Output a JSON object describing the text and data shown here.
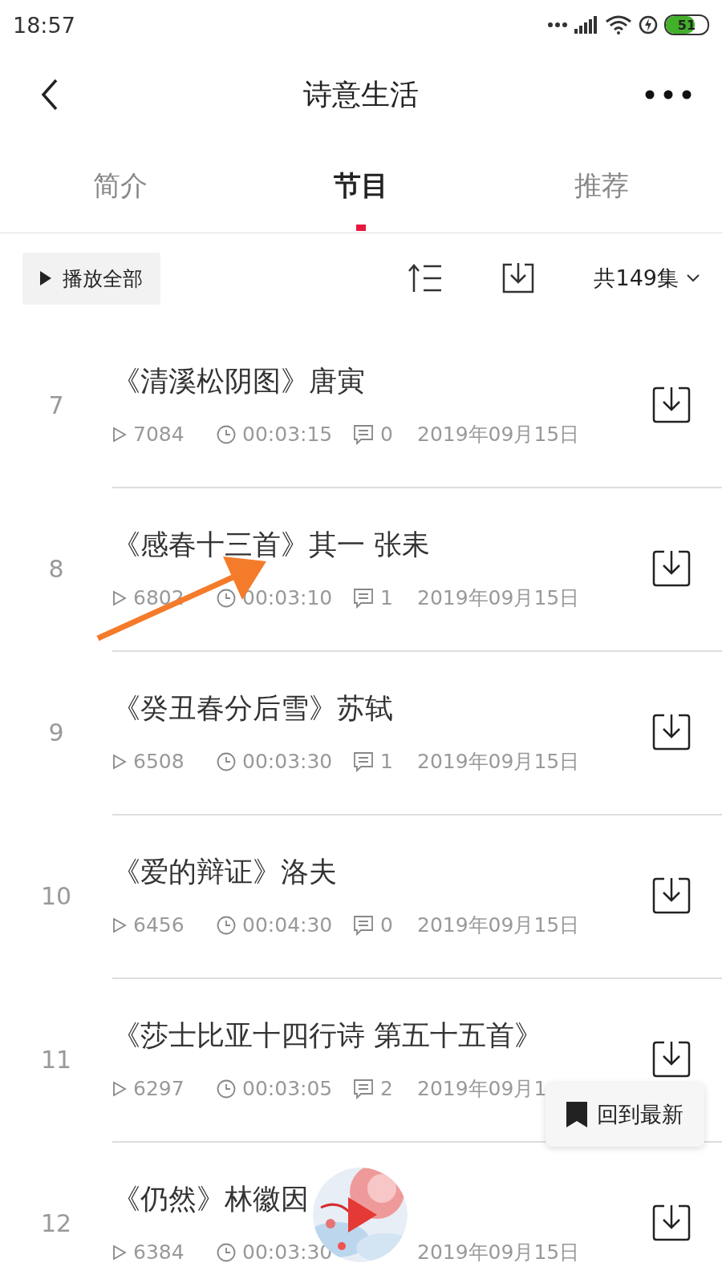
{
  "status_bar": {
    "time": "18:57",
    "battery": "51"
  },
  "header": {
    "title": "诗意生活"
  },
  "tabs": [
    {
      "label": "简介",
      "selected": false
    },
    {
      "label": "节目",
      "selected": true
    },
    {
      "label": "推荐",
      "selected": false
    }
  ],
  "toolbar": {
    "play_all": "播放全部",
    "count": "共149集"
  },
  "episodes": [
    {
      "index": "7",
      "title": "《清溪松阴图》唐寅",
      "plays": "7084",
      "duration": "00:03:15",
      "comments": "0",
      "date": "2019年09月15日"
    },
    {
      "index": "8",
      "title": "《感春十三首》其一 张耒",
      "plays": "6802",
      "duration": "00:03:10",
      "comments": "1",
      "date": "2019年09月15日"
    },
    {
      "index": "9",
      "title": "《癸丑春分后雪》苏轼",
      "plays": "6508",
      "duration": "00:03:30",
      "comments": "1",
      "date": "2019年09月15日"
    },
    {
      "index": "10",
      "title": "《爱的辩证》洛夫",
      "plays": "6456",
      "duration": "00:04:30",
      "comments": "0",
      "date": "2019年09月15日"
    },
    {
      "index": "11",
      "title": "《莎士比亚十四行诗 第五十五首》",
      "plays": "6297",
      "duration": "00:03:05",
      "comments": "2",
      "date": "2019年09月1"
    },
    {
      "index": "12",
      "title": "《仍然》林徽因",
      "plays": "6384",
      "duration": "00:03:30",
      "date": "2019年09月15日"
    }
  ],
  "back_to_latest": "回到最新"
}
